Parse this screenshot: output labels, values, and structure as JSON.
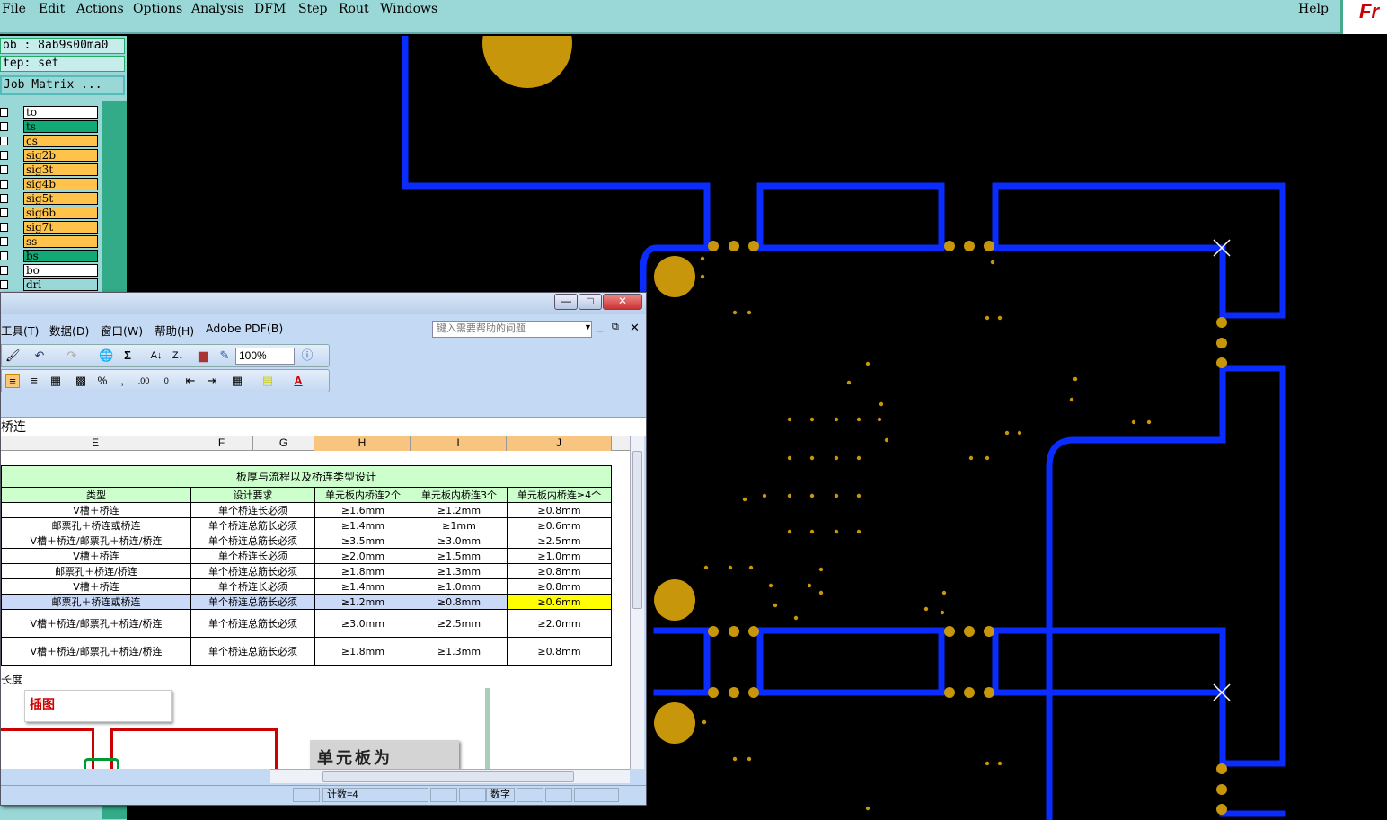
{
  "menubar": {
    "items": [
      "File",
      "Edit",
      "Actions",
      "Options",
      "Analysis",
      "DFM",
      "Step",
      "Rout",
      "Windows"
    ],
    "help": "Help",
    "logo_text": "Fr"
  },
  "left_panel": {
    "job": "ob : 8ab9s00ma0",
    "step": "tep: set",
    "job_matrix": "Job Matrix ...",
    "layers": [
      {
        "name": "to",
        "color": "#ffffff"
      },
      {
        "name": "ts",
        "color": "#11aa77"
      },
      {
        "name": "cs",
        "color": "#ffc24a"
      },
      {
        "name": "sig2b",
        "color": "#ffc24a"
      },
      {
        "name": "sig3t",
        "color": "#ffc24a"
      },
      {
        "name": "sig4b",
        "color": "#ffc24a"
      },
      {
        "name": "sig5t",
        "color": "#ffc24a"
      },
      {
        "name": "sig6b",
        "color": "#ffc24a"
      },
      {
        "name": "sig7t",
        "color": "#ffc24a"
      },
      {
        "name": "ss",
        "color": "#ffc24a"
      },
      {
        "name": "bs",
        "color": "#11aa77"
      },
      {
        "name": "bo",
        "color": "#ffffff"
      },
      {
        "name": "drl",
        "color": "#9ad7d7"
      }
    ]
  },
  "pcb": {
    "trace_color": "#0a2cff",
    "pad_color": "#c8960a",
    "background": "#000000"
  },
  "excel": {
    "menu": [
      "工具(T)",
      "数据(D)",
      "窗口(W)",
      "帮助(H)",
      "Adobe PDF(B)"
    ],
    "help_placeholder": "键入需要帮助的问题",
    "zoom": "100%",
    "formula_text": "桥连",
    "columns": [
      "E",
      "F",
      "G",
      "H",
      "I",
      "J"
    ],
    "table": {
      "title": "板厚与流程以及桥连类型设计",
      "headers": [
        "类型",
        "设计要求",
        "单元板内桥连2个",
        "单元板内桥连3个",
        "单元板内桥连≥4个"
      ],
      "rows": [
        [
          "V槽＋桥连",
          "单个桥连长必须",
          "≥1.6mm",
          "≥1.2mm",
          "≥0.8mm"
        ],
        [
          "邮票孔＋桥连或桥连",
          "单个桥连总筋长必须",
          "≥1.4mm",
          "≥1mm",
          "≥0.6mm"
        ],
        [
          "V槽＋桥连/邮票孔＋桥连/桥连",
          "单个桥连总筋长必须",
          "≥3.5mm",
          "≥3.0mm",
          "≥2.5mm"
        ],
        [
          "V槽＋桥连",
          "单个桥连长必须",
          "≥2.0mm",
          "≥1.5mm",
          "≥1.0mm"
        ],
        [
          "邮票孔＋桥连/桥连",
          "单个桥连总筋长必须",
          "≥1.8mm",
          "≥1.3mm",
          "≥0.8mm"
        ],
        [
          "V槽＋桥连",
          "单个桥连长必须",
          "≥1.4mm",
          "≥1.0mm",
          "≥0.8mm"
        ],
        [
          "邮票孔＋桥连或桥连",
          "单个桥连总筋长必须",
          "≥1.2mm",
          "≥0.8mm",
          "≥0.6mm"
        ],
        [
          "V槽＋桥连/邮票孔＋桥连/桥连",
          "单个桥连总筋长必须",
          "≥3.0mm",
          "≥2.5mm",
          "≥2.0mm"
        ],
        [
          "V槽＋桥连/邮票孔＋桥连/桥连",
          "单个桥连总筋长必须",
          "≥1.8mm",
          "≥1.3mm",
          "≥0.8mm"
        ]
      ],
      "note": "长度"
    },
    "insert_label": "插图",
    "insert_text": "单元板为",
    "status": {
      "count": "计数=4",
      "mode": "数字"
    }
  }
}
